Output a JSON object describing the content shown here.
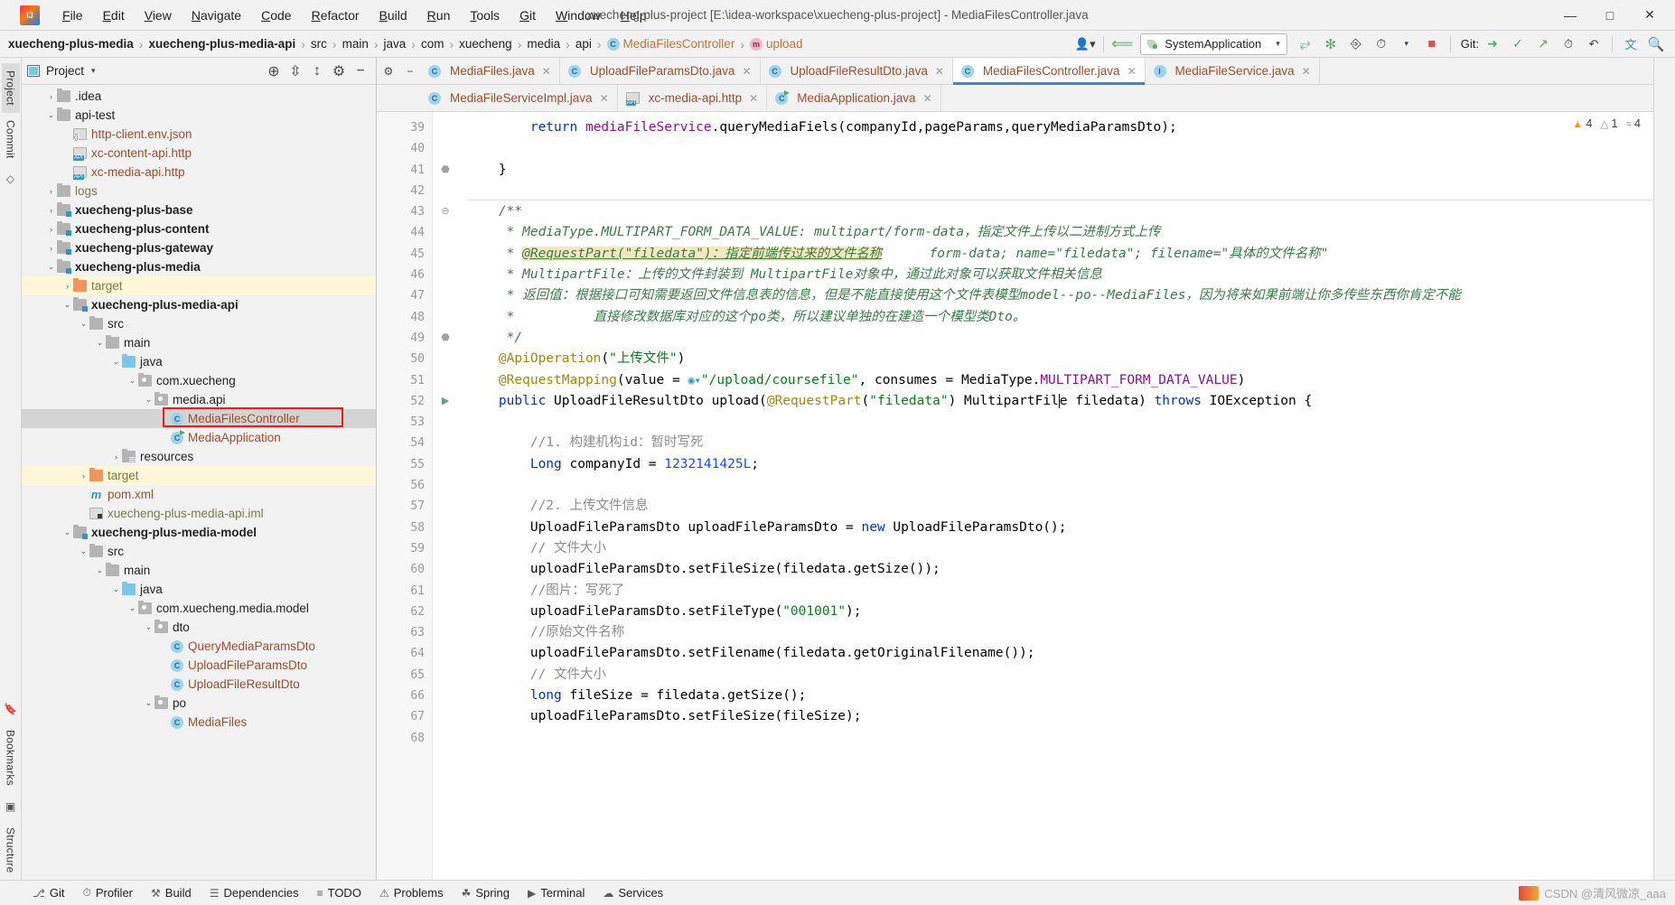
{
  "window": {
    "title": "xuecheng-plus-project [E:\\idea-workspace\\xuecheng-plus-project] - MediaFilesController.java",
    "minimize": "—",
    "maximize": "□",
    "close": "✕"
  },
  "menu": [
    "File",
    "Edit",
    "View",
    "Navigate",
    "Code",
    "Refactor",
    "Build",
    "Run",
    "Tools",
    "Git",
    "Window",
    "Help"
  ],
  "breadcrumbs": [
    {
      "label": "xuecheng-plus-media",
      "style": "bold"
    },
    {
      "label": "xuecheng-plus-media-api",
      "style": "bold"
    },
    {
      "label": "src",
      "style": "plain"
    },
    {
      "label": "main",
      "style": "plain"
    },
    {
      "label": "java",
      "style": "plain"
    },
    {
      "label": "com",
      "style": "plain"
    },
    {
      "label": "xuecheng",
      "style": "plain"
    },
    {
      "label": "media",
      "style": "plain"
    },
    {
      "label": "api",
      "style": "plain"
    },
    {
      "label": "MediaFilesController",
      "style": "class",
      "icon": "C"
    },
    {
      "label": "upload",
      "style": "method",
      "icon": "m"
    }
  ],
  "toolbar": {
    "run_config": "SystemApplication",
    "git_label": "Git:",
    "profile_icon": "▾",
    "back_icon": "↖",
    "run_icon": "▶",
    "debug_icon": "✱",
    "run_with_coverage_icon": "▷",
    "profiler_icon": "◔",
    "stop_icon": "■",
    "update_icon": "↓",
    "commit_icon": "✓",
    "push_icon": "↗",
    "history_icon": "◴",
    "rollback_icon": "↺",
    "translate_icon": "文A",
    "search_icon": "⌕"
  },
  "left_rail": {
    "project_tab": "Project",
    "commit_tab": "Commit",
    "bookmarks_tab": "Bookmarks",
    "structure_tab": "Structure"
  },
  "project_panel": {
    "title": "Project",
    "actions": [
      "target-icon",
      "collapse-icon",
      "expand-icon",
      "gear-icon",
      "hide-icon"
    ],
    "tree": [
      {
        "indent": 1,
        "arrow": "›",
        "icon": "folder-gray",
        "label": ".idea",
        "style": "plain"
      },
      {
        "indent": 1,
        "arrow": "⌄",
        "icon": "folder-gray",
        "label": "api-test",
        "style": "plain"
      },
      {
        "indent": 2,
        "arrow": "",
        "icon": "json-file",
        "label": "http-client.env.json",
        "style": "brown"
      },
      {
        "indent": 2,
        "arrow": "",
        "icon": "http-file",
        "label": "xc-content-api.http",
        "style": "brown"
      },
      {
        "indent": 2,
        "arrow": "",
        "icon": "http-file",
        "label": "xc-media-api.http",
        "style": "brown"
      },
      {
        "indent": 1,
        "arrow": "›",
        "icon": "folder-gray",
        "label": "logs",
        "style": "olive"
      },
      {
        "indent": 1,
        "arrow": "›",
        "icon": "module",
        "label": "xuecheng-plus-base",
        "style": "bold"
      },
      {
        "indent": 1,
        "arrow": "›",
        "icon": "module",
        "label": "xuecheng-plus-content",
        "style": "bold"
      },
      {
        "indent": 1,
        "arrow": "›",
        "icon": "module",
        "label": "xuecheng-plus-gateway",
        "style": "bold"
      },
      {
        "indent": 1,
        "arrow": "⌄",
        "icon": "module",
        "label": "xuecheng-plus-media",
        "style": "bold"
      },
      {
        "indent": 2,
        "arrow": "›",
        "icon": "folder-orange",
        "label": "target",
        "style": "olive",
        "row": "highlight"
      },
      {
        "indent": 2,
        "arrow": "⌄",
        "icon": "module",
        "label": "xuecheng-plus-media-api",
        "style": "bold"
      },
      {
        "indent": 3,
        "arrow": "⌄",
        "icon": "folder-gray",
        "label": "src",
        "style": "plain"
      },
      {
        "indent": 4,
        "arrow": "⌄",
        "icon": "folder-gray",
        "label": "main",
        "style": "plain"
      },
      {
        "indent": 5,
        "arrow": "⌄",
        "icon": "folder-blue",
        "label": "java",
        "style": "plain"
      },
      {
        "indent": 6,
        "arrow": "⌄",
        "icon": "package",
        "label": "com.xuecheng",
        "style": "plain"
      },
      {
        "indent": 7,
        "arrow": "⌄",
        "icon": "package",
        "label": "media.api",
        "style": "plain"
      },
      {
        "indent": 8,
        "arrow": "",
        "icon": "class",
        "label": "MediaFilesController",
        "style": "brown",
        "row": "selected",
        "boxed": true
      },
      {
        "indent": 8,
        "arrow": "",
        "icon": "spring",
        "label": "MediaApplication",
        "style": "brown"
      },
      {
        "indent": 5,
        "arrow": "›",
        "icon": "resources",
        "label": "resources",
        "style": "plain"
      },
      {
        "indent": 3,
        "arrow": "›",
        "icon": "folder-orange",
        "label": "target",
        "style": "olive",
        "row": "highlight"
      },
      {
        "indent": 3,
        "arrow": "",
        "icon": "maven",
        "label": "pom.xml",
        "style": "brown"
      },
      {
        "indent": 3,
        "arrow": "",
        "icon": "iml",
        "label": "xuecheng-plus-media-api.iml",
        "style": "olive"
      },
      {
        "indent": 2,
        "arrow": "⌄",
        "icon": "module",
        "label": "xuecheng-plus-media-model",
        "style": "bold"
      },
      {
        "indent": 3,
        "arrow": "⌄",
        "icon": "folder-gray",
        "label": "src",
        "style": "plain"
      },
      {
        "indent": 4,
        "arrow": "⌄",
        "icon": "folder-gray",
        "label": "main",
        "style": "plain"
      },
      {
        "indent": 5,
        "arrow": "⌄",
        "icon": "folder-blue",
        "label": "java",
        "style": "plain"
      },
      {
        "indent": 6,
        "arrow": "⌄",
        "icon": "package",
        "label": "com.xuecheng.media.model",
        "style": "plain"
      },
      {
        "indent": 7,
        "arrow": "⌄",
        "icon": "package",
        "label": "dto",
        "style": "plain"
      },
      {
        "indent": 8,
        "arrow": "",
        "icon": "class",
        "label": "QueryMediaParamsDto",
        "style": "brown"
      },
      {
        "indent": 8,
        "arrow": "",
        "icon": "class",
        "label": "UploadFileParamsDto",
        "style": "brown"
      },
      {
        "indent": 8,
        "arrow": "",
        "icon": "class",
        "label": "UploadFileResultDto",
        "style": "brown"
      },
      {
        "indent": 7,
        "arrow": "⌄",
        "icon": "package",
        "label": "po",
        "style": "plain"
      },
      {
        "indent": 8,
        "arrow": "",
        "icon": "class",
        "label": "MediaFiles",
        "style": "brown"
      }
    ]
  },
  "editor": {
    "tabs_row1": [
      {
        "label": "MediaFiles.java",
        "icon": "class",
        "active": false
      },
      {
        "label": "UploadFileParamsDto.java",
        "icon": "class",
        "active": false
      },
      {
        "label": "UploadFileResultDto.java",
        "icon": "class",
        "active": false
      },
      {
        "label": "MediaFilesController.java",
        "icon": "class",
        "active": true
      },
      {
        "label": "MediaFileService.java",
        "icon": "interface",
        "active": false
      }
    ],
    "tabs_row2": [
      {
        "label": "MediaFileServiceImpl.java",
        "icon": "class",
        "active": false
      },
      {
        "label": "xc-media-api.http",
        "icon": "http",
        "active": false
      },
      {
        "label": "MediaApplication.java",
        "icon": "spring",
        "active": false
      }
    ],
    "close_glyph": "✕",
    "inspection": {
      "warnings": "4",
      "warnings_icon": "⚠",
      "weak_warnings": "1",
      "weak_warnings_icon": "⚠",
      "typos": "4",
      "typos_icon": "≈"
    },
    "first_line_number": 39,
    "lines": [
      {
        "n": 39,
        "fold": "",
        "html": "        <k>return</k> <f>mediaFileService</f>.<m>queryMediaFiels</m>(companyId,pageParams,queryMediaParamsDto);"
      },
      {
        "n": 40,
        "fold": "",
        "html": ""
      },
      {
        "n": 41,
        "fold": "end",
        "html": "    }"
      },
      {
        "n": 42,
        "fold": "",
        "html": ""
      },
      {
        "n": 43,
        "fold": "start",
        "html": "    <d>/**</d>",
        "gapAbove": true
      },
      {
        "n": 44,
        "fold": "",
        "html": "     <d>* MediaType.MULTIPART_FORM_DATA_VALUE: multipart/form-data，指定文件上传以二进制方式上传</d>"
      },
      {
        "n": 45,
        "fold": "",
        "html": "     <d>* </d><hl>@RequestPart(\"filedata\")：指定前端传过来的文件名称</hl><d>      form-data; name=\"filedata\"; filename=\"具体的文件名称\"</d>"
      },
      {
        "n": 46,
        "fold": "",
        "html": "     <d>* MultipartFile：上传的文件封装到 MultipartFile对象中，通过此对象可以获取文件相关信息</d>"
      },
      {
        "n": 47,
        "fold": "",
        "html": "     <d>* 返回值：根据接口可知需要返回文件信息表的信息，但是不能直接使用这个文件表模型model--po--MediaFiles，因为将来如果前端让你多传些东西你肯定不能</d>"
      },
      {
        "n": 48,
        "fold": "",
        "html": "     <d>*          直接修改数据库对应的这个po类，所以建议单独的在建造一个模型类Dto。</d>"
      },
      {
        "n": 49,
        "fold": "end",
        "html": "     <d>*/</d>"
      },
      {
        "n": 50,
        "fold": "",
        "html": "    <a>@ApiOperation</a>(<s>\"上传文件\"</s>)"
      },
      {
        "n": 51,
        "fold": "",
        "html": "    <a>@RequestMapping</a>(value = <gl>◉▾</gl><s>\"/upload/coursefile\"</s>, consumes = MediaType.<f>MULTIPART_FORM_DATA_VALUE</f>)"
      },
      {
        "n": 52,
        "fold": "",
        "gutterIcons": "run-method",
        "html": "    <k>public</k> UploadFileResultDto <m>upload</m>(<a>@RequestPart</a>(<s>\"filedata\"</s>) MultipartFil<cur>e</cur> filedata) <k>throws</k> IOException {"
      },
      {
        "n": 53,
        "fold": "",
        "html": ""
      },
      {
        "n": 54,
        "fold": "",
        "html": "        <c>//1. 构建机构id：暂时写死</c>"
      },
      {
        "n": 55,
        "fold": "",
        "html": "        <k>Long</k> companyId = <n>1232141425L</n>;"
      },
      {
        "n": 56,
        "fold": "",
        "html": ""
      },
      {
        "n": 57,
        "fold": "",
        "html": "        <c>//2. 上传文件信息</c>"
      },
      {
        "n": 58,
        "fold": "",
        "html": "        UploadFileParamsDto uploadFileParamsDto = <k>new</k> UploadFileParamsDto();"
      },
      {
        "n": 59,
        "fold": "",
        "html": "        <c>// 文件大小</c>"
      },
      {
        "n": 60,
        "fold": "",
        "html": "        uploadFileParamsDto.setFileSize(filedata.getSize());"
      },
      {
        "n": 61,
        "fold": "",
        "html": "        <c>//图片：写死了</c>"
      },
      {
        "n": 62,
        "fold": "",
        "html": "        uploadFileParamsDto.setFileType(<s>\"001001\"</s>);"
      },
      {
        "n": 63,
        "fold": "",
        "html": "        <c>//原始文件名称</c>"
      },
      {
        "n": 64,
        "fold": "",
        "html": "        uploadFileParamsDto.setFilename(filedata.getOriginalFilename());"
      },
      {
        "n": 65,
        "fold": "",
        "html": "        <c>// 文件大小</c>"
      },
      {
        "n": 66,
        "fold": "",
        "html": "        <k>long</k> fileSize = filedata.getSize();"
      },
      {
        "n": 67,
        "fold": "",
        "html": "        uploadFileParamsDto.setFileSize(fileSize);"
      },
      {
        "n": 68,
        "fold": "",
        "html": ""
      }
    ]
  },
  "status_bar": {
    "items": [
      {
        "icon": "git-icon",
        "label": "Git"
      },
      {
        "icon": "profiler-icon",
        "label": "Profiler"
      },
      {
        "icon": "build-icon",
        "label": "Build"
      },
      {
        "icon": "dependencies-icon",
        "label": "Dependencies"
      },
      {
        "icon": "todo-icon",
        "label": "TODO"
      },
      {
        "icon": "problems-icon",
        "label": "Problems"
      },
      {
        "icon": "spring-icon",
        "label": "Spring"
      },
      {
        "icon": "terminal-icon",
        "label": "Terminal"
      },
      {
        "icon": "services-icon",
        "label": "Services"
      }
    ],
    "watermark": "CSDN @清风微凉_aaa"
  },
  "colors": {
    "accent_blue": "#4083c9",
    "tab_text_brown": "#9d4c2a",
    "highlight_yellow": "#f7e7c0",
    "selection_gray": "#d4d4d4",
    "annotation_red": "#ef1b1b",
    "row_highlight": "#fdf6d8"
  }
}
